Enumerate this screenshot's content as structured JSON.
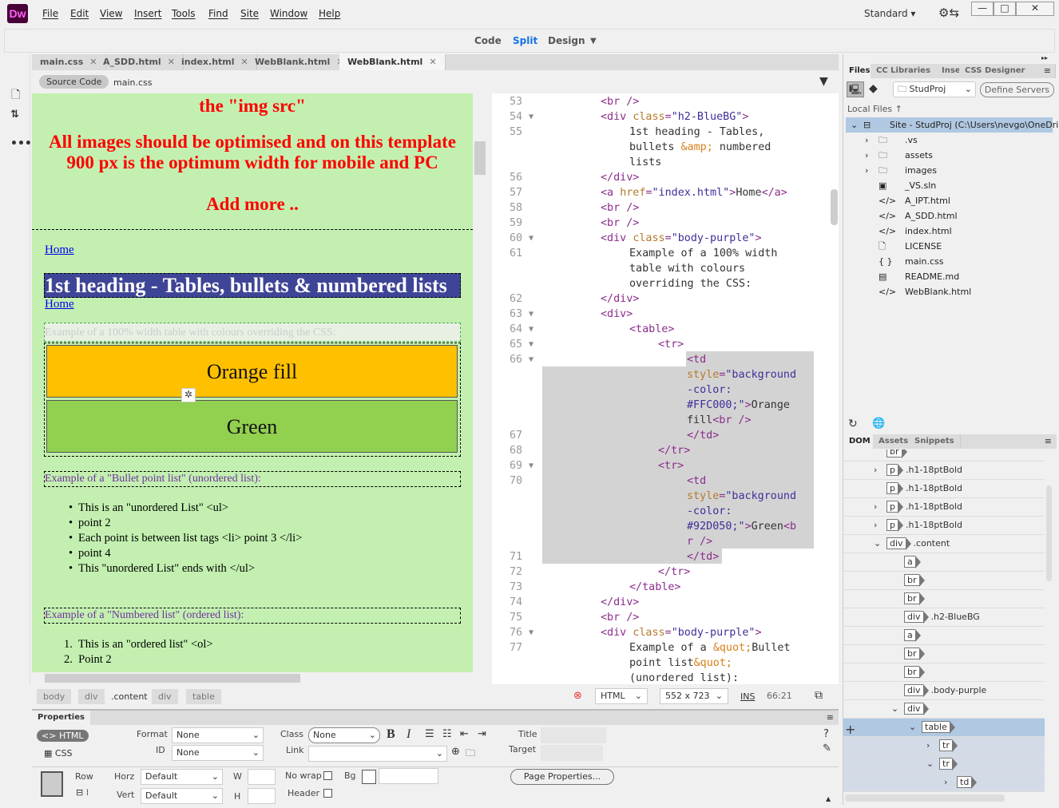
{
  "app": {
    "logo": "Dw",
    "workspace": "Standard",
    "accent": "#470137"
  },
  "menu": [
    "File",
    "Edit",
    "View",
    "Insert",
    "Tools",
    "Find",
    "Site",
    "Window",
    "Help"
  ],
  "view_modes": {
    "code": "Code",
    "split": "Split",
    "design": "Design",
    "active": "Split"
  },
  "tabs": [
    {
      "label": "main.css"
    },
    {
      "label": "A_SDD.html"
    },
    {
      "label": "index.html"
    },
    {
      "label": "WebBlank.html"
    },
    {
      "label": "WebBlank.html",
      "active": true
    }
  ],
  "source_bar": {
    "source_code": "Source Code",
    "related": "main.css"
  },
  "design": {
    "red_lines": [
      "the \"img src\"",
      "All images should be optimised and on this template",
      "900 px is the optimum width for mobile and PC",
      "Add more .."
    ],
    "home": "Home",
    "heading": "1st heading - Tables, bullets & numbered lists",
    "table_caption": "Example of a 100% width table with colours overriding the CSS:",
    "orange": {
      "label": "Orange fill",
      "color": "#FFC000"
    },
    "green": {
      "label": "Green",
      "color": "#92D050"
    },
    "bullet_title": "Example of a \"Bullet point list\" (unordered list):",
    "bullets": [
      "This is an \"unordered List\" <ul>",
      "point 2",
      "Each point is between list tags <li> point 3 </li>",
      "point 4",
      "This \"unordered List\" ends with </ul>"
    ],
    "numbered_title": "Example of a \"Numbered list\" (ordered list):",
    "numbered": [
      "This is an \"ordered list\" <ol>",
      "Point 2"
    ]
  },
  "code_rows": [
    {
      "n": "53",
      "i": 2,
      "t": [
        [
          "tag",
          "<br />"
        ]
      ]
    },
    {
      "n": "54",
      "f": 1,
      "i": 2,
      "t": [
        [
          "tag",
          "<div "
        ],
        [
          "attr",
          "class"
        ],
        [
          "tag",
          "="
        ],
        [
          "str",
          "\"h2-BlueBG\""
        ],
        [
          "tag",
          ">"
        ]
      ]
    },
    {
      "n": "55",
      "i": 3,
      "t": [
        [
          "txt",
          "1st heading - Tables,"
        ]
      ]
    },
    {
      "i": 3,
      "t": [
        [
          "txt",
          "bullets "
        ],
        [
          "ent",
          "&amp;"
        ],
        [
          "txt",
          " numbered"
        ]
      ]
    },
    {
      "i": 3,
      "t": [
        [
          "txt",
          "lists"
        ]
      ]
    },
    {
      "n": "56",
      "i": 2,
      "t": [
        [
          "tag",
          "</div>"
        ]
      ]
    },
    {
      "n": "57",
      "i": 2,
      "t": [
        [
          "tag",
          "<a "
        ],
        [
          "attr",
          "href"
        ],
        [
          "tag",
          "="
        ],
        [
          "str",
          "\"index.html\""
        ],
        [
          "tag",
          ">"
        ],
        [
          "txt",
          "Home"
        ],
        [
          "tag",
          "</a>"
        ]
      ]
    },
    {
      "n": "58",
      "i": 2,
      "t": [
        [
          "tag",
          "<br />"
        ]
      ]
    },
    {
      "n": "59",
      "i": 2,
      "t": [
        [
          "tag",
          "<br />"
        ]
      ]
    },
    {
      "n": "60",
      "f": 1,
      "i": 2,
      "t": [
        [
          "tag",
          "<div "
        ],
        [
          "attr",
          "class"
        ],
        [
          "tag",
          "="
        ],
        [
          "str",
          "\"body-purple\""
        ],
        [
          "tag",
          ">"
        ]
      ]
    },
    {
      "n": "61",
      "i": 3,
      "t": [
        [
          "txt",
          "Example of a 100% width"
        ]
      ]
    },
    {
      "i": 3,
      "t": [
        [
          "txt",
          "table with colours"
        ]
      ]
    },
    {
      "i": 3,
      "t": [
        [
          "txt",
          "overriding the CSS:"
        ]
      ]
    },
    {
      "n": "62",
      "i": 2,
      "t": [
        [
          "tag",
          "</div>"
        ]
      ]
    },
    {
      "n": "63",
      "f": 1,
      "i": 2,
      "t": [
        [
          "tag",
          "<div>"
        ]
      ]
    },
    {
      "n": "64",
      "f": 1,
      "i": 3,
      "t": [
        [
          "tag",
          "<table>"
        ]
      ]
    },
    {
      "n": "65",
      "f": 1,
      "i": 4,
      "t": [
        [
          "tag",
          "<tr>"
        ]
      ]
    },
    {
      "n": "66",
      "f": 1,
      "i": 5,
      "t": [
        [
          "tag",
          "<td"
        ]
      ]
    },
    {
      "i": 5,
      "t": [
        [
          "attr",
          "style"
        ],
        [
          "tag",
          "="
        ],
        [
          "str",
          "\"background"
        ]
      ]
    },
    {
      "i": 5,
      "t": [
        [
          "str",
          "-color:"
        ]
      ]
    },
    {
      "i": 5,
      "t": [
        [
          "str",
          "#FFC000;\""
        ],
        [
          "tag",
          ">"
        ],
        [
          "txt",
          "Orange"
        ]
      ]
    },
    {
      "i": 5,
      "t": [
        [
          "txt",
          "fill"
        ],
        [
          "tag",
          "<br />"
        ]
      ]
    },
    {
      "n": "67",
      "i": 5,
      "t": [
        [
          "tag",
          "</td>"
        ]
      ]
    },
    {
      "n": "68",
      "i": 4,
      "t": [
        [
          "tag",
          "</tr>"
        ]
      ]
    },
    {
      "n": "69",
      "f": 1,
      "i": 4,
      "t": [
        [
          "tag",
          "<tr>"
        ]
      ]
    },
    {
      "n": "70",
      "i": 5,
      "t": [
        [
          "tag",
          "<td"
        ]
      ]
    },
    {
      "i": 5,
      "t": [
        [
          "attr",
          "style"
        ],
        [
          "tag",
          "="
        ],
        [
          "str",
          "\"background"
        ]
      ]
    },
    {
      "i": 5,
      "t": [
        [
          "str",
          "-color:"
        ]
      ]
    },
    {
      "i": 5,
      "t": [
        [
          "str",
          "#92D050;\""
        ],
        [
          "tag",
          ">"
        ],
        [
          "txt",
          "Green"
        ],
        [
          "tag",
          "<b"
        ]
      ]
    },
    {
      "i": 5,
      "t": [
        [
          "tag",
          "r />"
        ]
      ]
    },
    {
      "n": "71",
      "i": 5,
      "t": [
        [
          "tag",
          "</td>"
        ]
      ]
    },
    {
      "n": "72",
      "i": 4,
      "t": [
        [
          "tag",
          "</tr>"
        ]
      ]
    },
    {
      "n": "73",
      "i": 3,
      "t": [
        [
          "tag",
          "</table>"
        ]
      ]
    },
    {
      "n": "74",
      "i": 2,
      "t": [
        [
          "tag",
          "</div>"
        ]
      ]
    },
    {
      "n": "75",
      "i": 2,
      "t": [
        [
          "tag",
          "<br />"
        ]
      ]
    },
    {
      "n": "76",
      "f": 1,
      "i": 2,
      "t": [
        [
          "tag",
          "<div "
        ],
        [
          "attr",
          "class"
        ],
        [
          "tag",
          "="
        ],
        [
          "str",
          "\"body-purple\""
        ],
        [
          "tag",
          ">"
        ]
      ]
    },
    {
      "n": "77",
      "i": 3,
      "t": [
        [
          "txt",
          "Example of a "
        ],
        [
          "ent",
          "&quot;"
        ],
        [
          "txt",
          "Bullet"
        ]
      ]
    },
    {
      "i": 3,
      "t": [
        [
          "txt",
          "point list"
        ],
        [
          "ent",
          "&quot;"
        ]
      ]
    },
    {
      "i": 3,
      "t": [
        [
          "txt",
          "(unordered list):"
        ]
      ]
    }
  ],
  "status_bar": {
    "crumbs": [
      "body",
      "div",
      ".content",
      "div",
      "table"
    ],
    "doc_type": "HTML",
    "size": "552 x 723",
    "mode": "INS",
    "position": "66:21"
  },
  "properties": {
    "title": "Properties",
    "html": "HTML",
    "css": "CSS",
    "format_label": "Format",
    "format": "None",
    "id_label": "ID",
    "id": "None",
    "class_label": "Class",
    "class": "None",
    "link_label": "Link",
    "link": "",
    "title_label": "Title",
    "target_label": "Target",
    "row_label": "Row",
    "horz_label": "Horz",
    "horz": "Default",
    "vert_label": "Vert",
    "vert": "Default",
    "w_label": "W",
    "h_label": "H",
    "nowrap_label": "No wrap",
    "bg_label": "Bg",
    "header_label": "Header",
    "page_properties": "Page Properties..."
  },
  "files_panel": {
    "tabs": [
      "Files",
      "CC Libraries",
      "Insert",
      "CSS Designer"
    ],
    "site": "StudProj",
    "define_servers": "Define Servers",
    "local_files": "Local Files",
    "root": "Site - StudProj (C:\\Users\\nevgo\\OneDri...",
    "items": [
      {
        "name": ".vs",
        "icon": "folder",
        "expand": true
      },
      {
        "name": "assets",
        "icon": "folder",
        "expand": true
      },
      {
        "name": "images",
        "icon": "folder",
        "expand": true
      },
      {
        "name": "_VS.sln",
        "icon": "vs"
      },
      {
        "name": "A_IPT.html",
        "icon": "code"
      },
      {
        "name": "A_SDD.html",
        "icon": "code"
      },
      {
        "name": "index.html",
        "icon": "code"
      },
      {
        "name": "LICENSE",
        "icon": "file"
      },
      {
        "name": "main.css",
        "icon": "braces"
      },
      {
        "name": "README.md",
        "icon": "notepad"
      },
      {
        "name": "WebBlank.html",
        "icon": "code"
      }
    ]
  },
  "dom_panel": {
    "tabs": [
      "DOM",
      "Assets",
      "Snippets"
    ],
    "rows": [
      {
        "tag": "br",
        "d": 2
      },
      {
        "tag": "p",
        "cls": ".h1-18ptBold",
        "d": 2,
        "exp": ">"
      },
      {
        "tag": "p",
        "cls": ".h1-18ptBold",
        "d": 2
      },
      {
        "tag": "p",
        "cls": ".h1-18ptBold",
        "d": 2,
        "exp": ">"
      },
      {
        "tag": "p",
        "cls": ".h1-18ptBold",
        "d": 2,
        "exp": ">"
      },
      {
        "tag": "div",
        "cls": ".content",
        "d": 2,
        "exp": "v"
      },
      {
        "tag": "a",
        "d": 3
      },
      {
        "tag": "br",
        "d": 3
      },
      {
        "tag": "br",
        "d": 3
      },
      {
        "tag": "div",
        "cls": ".h2-BlueBG",
        "d": 3
      },
      {
        "tag": "a",
        "d": 3
      },
      {
        "tag": "br",
        "d": 3
      },
      {
        "tag": "br",
        "d": 3
      },
      {
        "tag": "div",
        "cls": ".body-purple",
        "d": 3
      },
      {
        "tag": "div",
        "d": 3,
        "exp": "v"
      },
      {
        "tag": "table",
        "d": 4,
        "exp": "v",
        "hl": 2
      },
      {
        "tag": "tr",
        "d": 5,
        "exp": ">",
        "hl": 1
      },
      {
        "tag": "tr",
        "d": 5,
        "exp": "v",
        "hl": 1
      },
      {
        "tag": "td",
        "d": 6,
        "exp": ">",
        "hl": 1
      }
    ]
  }
}
